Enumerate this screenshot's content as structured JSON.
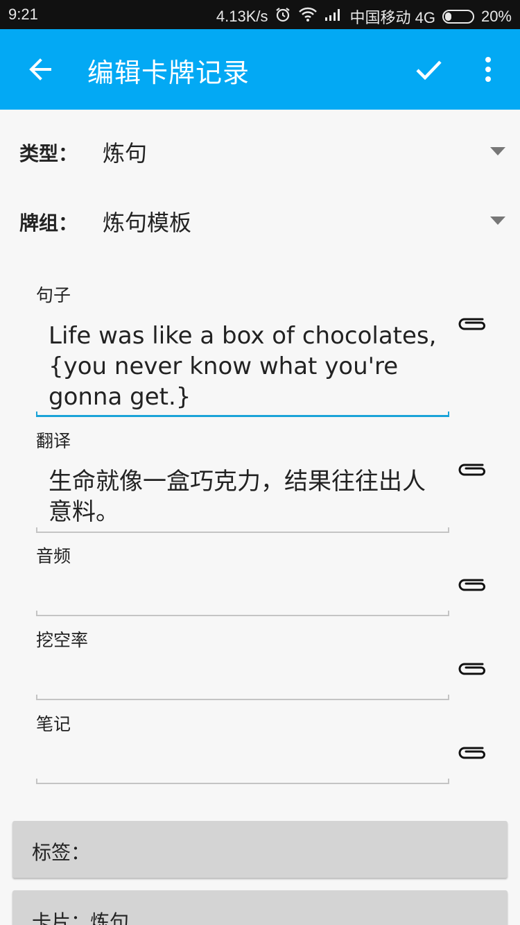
{
  "status_bar": {
    "time": "9:21",
    "speed": "4.13K/s",
    "carrier": "中国移动 4G",
    "battery": "20%"
  },
  "app_bar": {
    "title": "编辑卡牌记录",
    "back_icon": "arrow-left-icon",
    "confirm_icon": "check-icon",
    "more_icon": "more-vert-icon",
    "color": "#03a9f4"
  },
  "type_row": {
    "label": "类型：",
    "value": "炼句"
  },
  "deck_row": {
    "label": "牌组：",
    "value": "炼句模板"
  },
  "fields": [
    {
      "label": "句子",
      "value": "Life was like a box of chocolates, {you never know what you're gonna get.}"
    },
    {
      "label": "翻译",
      "value": "生命就像一盒巧克力，结果往往出人意料。"
    },
    {
      "label": "音频",
      "value": ""
    },
    {
      "label": "挖空率",
      "value": ""
    },
    {
      "label": "笔记",
      "value": ""
    }
  ],
  "tags_panel": {
    "label": "标签："
  },
  "cards_panel": {
    "label": "卡片：炼句"
  },
  "colors": {
    "accent": "#03a9f4",
    "underline_active": "#1aa3d8",
    "underline": "#c4c4c4"
  }
}
